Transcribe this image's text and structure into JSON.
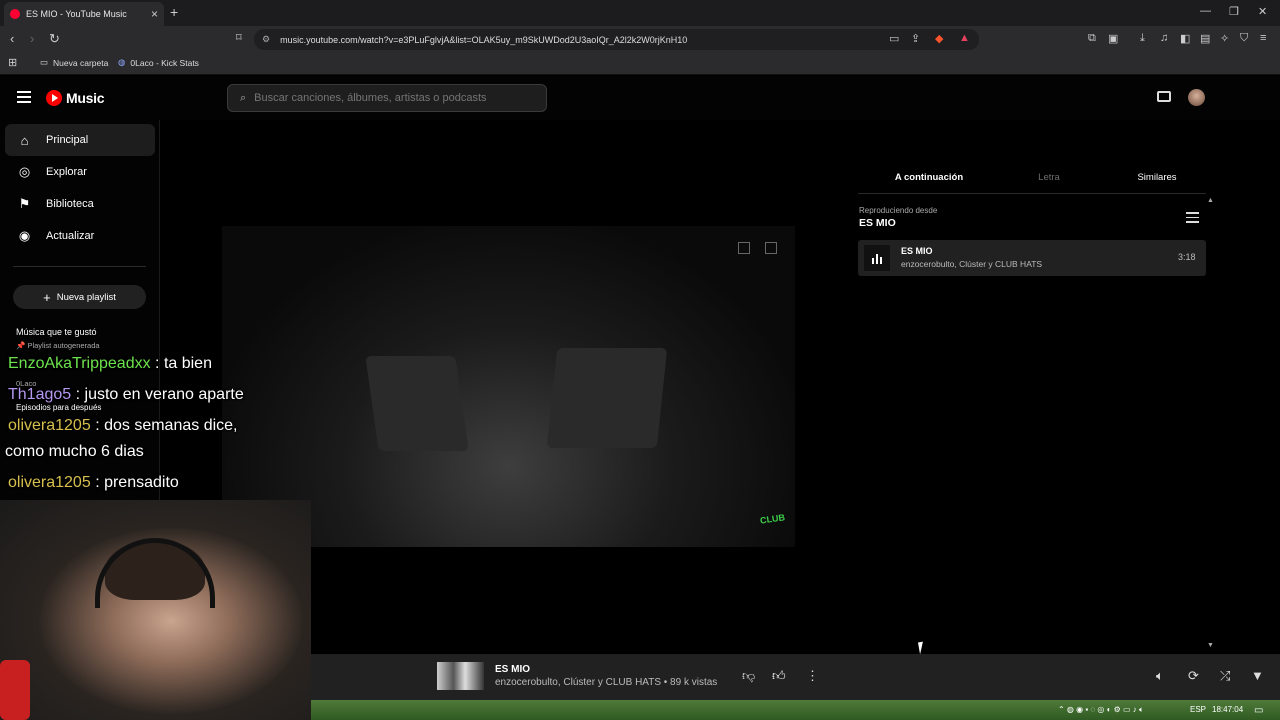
{
  "browser": {
    "tab_title": "ES MIO - YouTube Music",
    "url": "music.youtube.com/watch?v=e3PLuFglvjA&list=OLAK5uy_m9SkUWDod2U3aoIQr_A2l2k2W0rjKnH10",
    "bookmarks": [
      {
        "label": "Nueva carpeta",
        "icon": "folder-icon"
      },
      {
        "label": "0Laco - Kick Stats",
        "icon": "kick-icon"
      }
    ]
  },
  "app": {
    "logo_text": "Music",
    "search_placeholder": "Buscar canciones, álbumes, artistas o podcasts"
  },
  "sidebar": {
    "items": [
      {
        "label": "Principal",
        "icon": "home-icon",
        "active": true
      },
      {
        "label": "Explorar",
        "icon": "compass-icon"
      },
      {
        "label": "Biblioteca",
        "icon": "bookmark-icon"
      },
      {
        "label": "Actualizar",
        "icon": "upgrade-icon"
      }
    ],
    "new_playlist": "Nueva playlist",
    "playlists": [
      {
        "title": "Música que te gustó",
        "subtitle": "Playlist autogenerada"
      },
      {
        "title": "0Laco",
        "subtitle": ""
      },
      {
        "title": "Episodios para después",
        "subtitle": ""
      }
    ]
  },
  "chat": [
    {
      "user": "EnzoAkaTrippeadxx",
      "text": ": ta bien"
    },
    {
      "user": "Th1ago5",
      "text": ": justo en verano aparte"
    },
    {
      "user": "olivera1205",
      "text": ": dos semanas dice,"
    },
    {
      "user": "",
      "text": "como mucho 6 dias"
    },
    {
      "user": "olivera1205",
      "text": ": prensadito"
    }
  ],
  "video": {
    "logo_text": "CLUB"
  },
  "right_panel": {
    "tabs": [
      "A continuación",
      "Letra",
      "Similares"
    ],
    "playing_from_label": "Reproduciendo desde",
    "playlist_name": "ES MIO",
    "queue": [
      {
        "title": "ES MIO",
        "artist": "enzocerobulto, Clúster y CLUB HATS",
        "duration": "3:18"
      }
    ]
  },
  "player": {
    "title": "ES MIO",
    "artist": "enzocerobulto, Clúster y CLUB HATS",
    "views": " • 89 k vistas"
  },
  "taskbar": {
    "language": "ESP",
    "time": "18:47:04"
  }
}
